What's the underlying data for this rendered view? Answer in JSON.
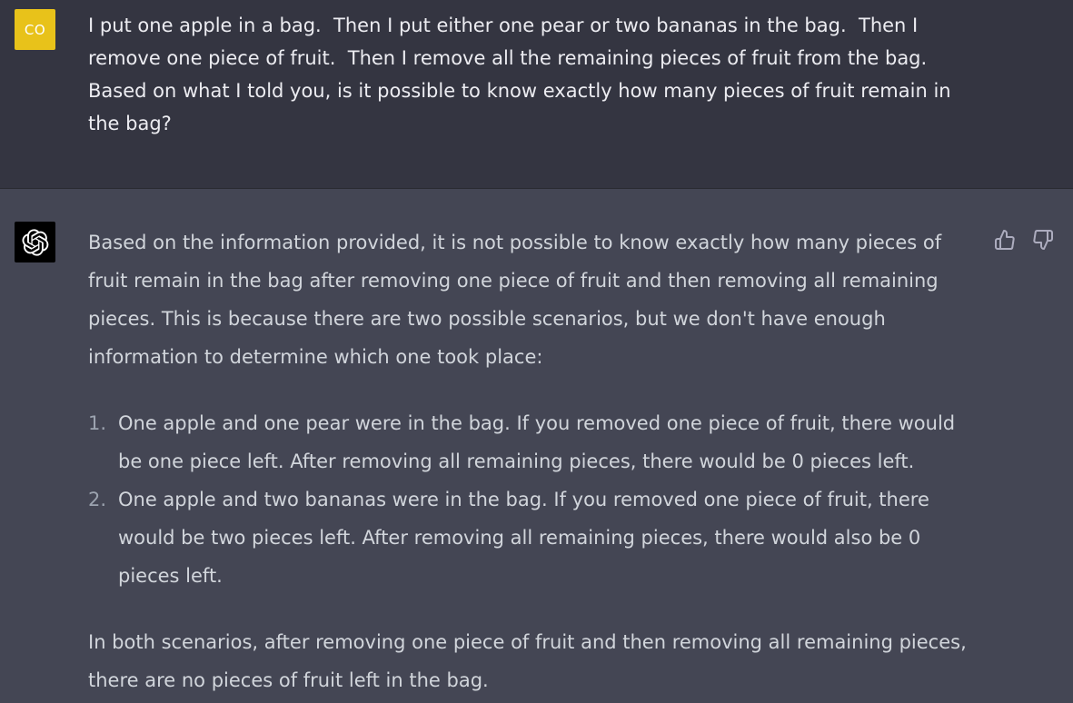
{
  "user": {
    "avatar_initials": "CO",
    "avatar_color": "#e8c21a",
    "message": "I put one apple in a bag.  Then I put either one pear or two bananas in the bag.  Then I remove one piece of fruit.  Then I remove all the remaining pieces of fruit from the bag.  Based on what I told you, is it possible to know exactly how many pieces of fruit remain in the bag?"
  },
  "assistant": {
    "avatar_icon": "openai-logo-icon",
    "intro": "Based on the information provided, it is not possible to know exactly how many pieces of fruit remain in the bag after removing one piece of fruit and then removing all remaining pieces. This is because there are two possible scenarios, but we don't have enough information to determine which one took place:",
    "list": [
      {
        "number": "1.",
        "text": "One apple and one pear were in the bag. If you removed one piece of fruit, there would be one piece left. After removing all remaining pieces, there would be 0 pieces left."
      },
      {
        "number": "2.",
        "text": "One apple and two bananas were in the bag. If you removed one piece of fruit, there would be two pieces left. After removing all remaining pieces, there would also be 0 pieces left."
      }
    ],
    "conclusion": "In both scenarios, after removing one piece of fruit and then removing all remaining pieces, there are no pieces of fruit left in the bag.",
    "feedback": {
      "like_icon": "thumbs-up-icon",
      "dislike_icon": "thumbs-down-icon"
    }
  },
  "colors": {
    "user_bg": "#343541",
    "assistant_bg": "#444654",
    "text": "#d1d5db"
  }
}
